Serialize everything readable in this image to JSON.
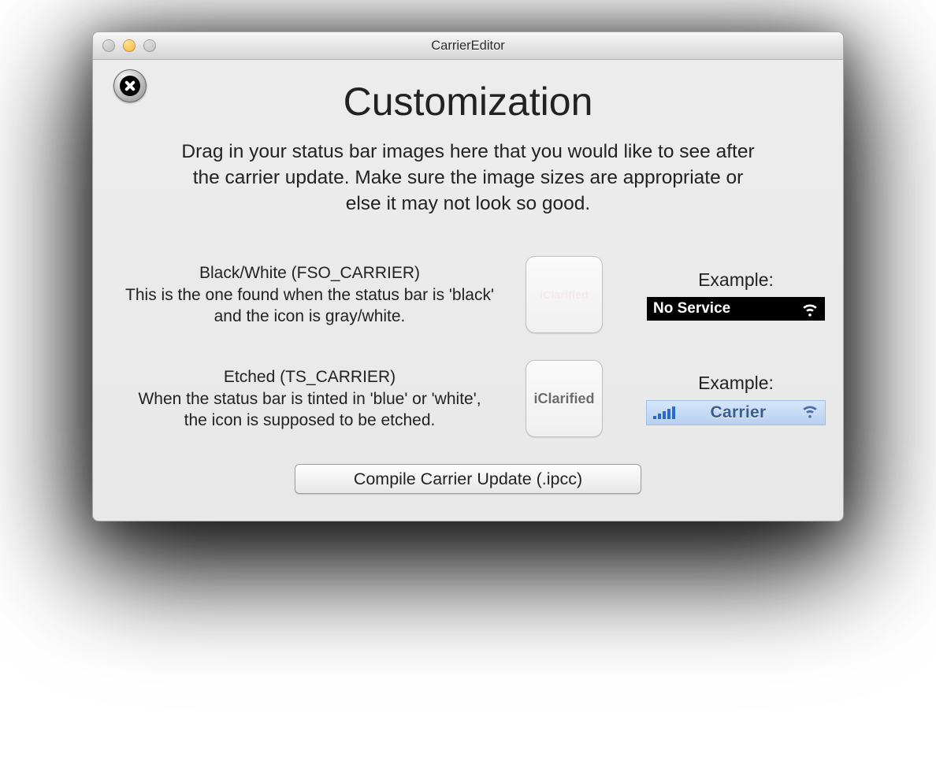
{
  "window": {
    "title": "CarrierEditor"
  },
  "page": {
    "heading": "Customization",
    "instructions": "Drag in your status bar images here that you would like to see after the carrier update. Make sure the image sizes are appropriate or else it may not look so good."
  },
  "rows": {
    "bw": {
      "label": "Black/White (FSO_CARRIER)",
      "desc": "This is the one found when the status bar is 'black' and the icon is gray/white.",
      "drop_preview_text": "iClarified",
      "example_label": "Example:",
      "example_status_text": "No Service"
    },
    "etched": {
      "label": "Etched (TS_CARRIER)",
      "desc": "When the status bar is tinted in 'blue' or 'white', the icon is supposed to be etched.",
      "drop_preview_text": "iClarified",
      "example_label": "Example:",
      "example_status_text": "Carrier"
    }
  },
  "actions": {
    "compile": "Compile Carrier Update (.ipcc)"
  }
}
